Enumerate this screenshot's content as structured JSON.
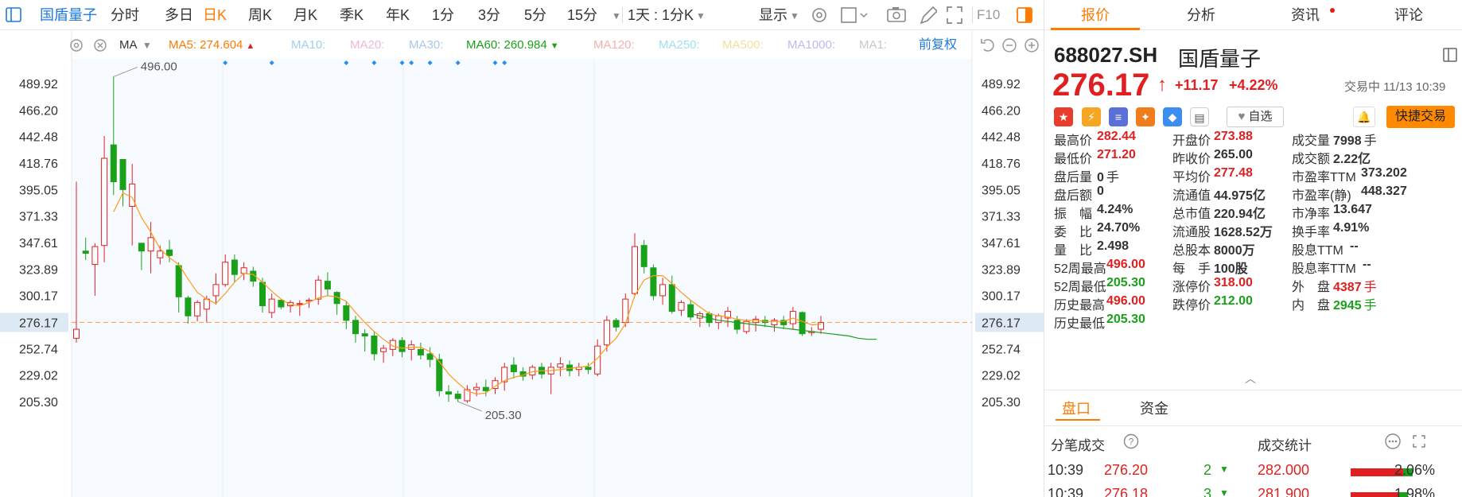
{
  "toolbar": {
    "stock_name": "国盾量子",
    "periods": [
      "分时",
      "多日",
      "日K",
      "周K",
      "月K",
      "季K",
      "年K",
      "1分",
      "3分",
      "5分",
      "15分"
    ],
    "active_period": "日K",
    "multi_period": "1天 : 1分K",
    "display_label": "显示",
    "f10_label": "F10"
  },
  "ma_bar": {
    "indicator": "MA",
    "items": [
      {
        "label": "MA5: 274.604",
        "color": "#ff7a00",
        "arrow": "▲"
      },
      {
        "label": "MA10:",
        "color": "#9fd0f0"
      },
      {
        "label": "MA20:",
        "color": "#f0b8d8"
      },
      {
        "label": "MA30:",
        "color": "#a8c8e8"
      },
      {
        "label": "MA60: 260.984",
        "color": "#1aa11a",
        "arrow": "▼"
      },
      {
        "label": "MA120:",
        "color": "#f4b0b0"
      },
      {
        "label": "MA250:",
        "color": "#9fe0f0"
      },
      {
        "label": "MA500:",
        "color": "#f0e0a0"
      },
      {
        "label": "MA1000:",
        "color": "#c0b8f0"
      },
      {
        "label": "MA1:",
        "color": "#c8c8c8"
      }
    ],
    "adjust_label": "前复权"
  },
  "colors": {
    "up": "#e02020",
    "down": "#1aa11a",
    "accent": "#ff7a00",
    "blue": "#1e7be0"
  },
  "chart_data": {
    "type": "candlestick",
    "y_ticks": [
      489.92,
      466.2,
      442.48,
      418.76,
      395.05,
      371.33,
      347.61,
      323.89,
      300.17,
      276.17,
      252.74,
      229.02,
      205.3
    ],
    "ylim": [
      198,
      500
    ],
    "current_price_label": "276.17",
    "high_annotation": "496.00",
    "low_annotation": "205.30",
    "candles": [
      [
        262,
        402,
        258,
        270
      ],
      [
        340,
        352,
        332,
        338
      ],
      [
        328,
        347,
        300,
        344
      ],
      [
        345,
        443,
        330,
        423
      ],
      [
        435,
        496,
        390,
        402
      ],
      [
        422,
        420,
        380,
        395
      ],
      [
        380,
        418,
        345,
        400
      ],
      [
        347,
        345,
        323,
        340
      ],
      [
        340,
        366,
        320,
        352
      ],
      [
        334,
        345,
        328,
        340
      ],
      [
        341,
        350,
        330,
        336
      ],
      [
        327,
        330,
        285,
        299
      ],
      [
        298,
        300,
        275,
        282
      ],
      [
        282,
        296,
        277,
        294
      ],
      [
        288,
        300,
        276,
        297
      ],
      [
        300,
        320,
        292,
        310
      ],
      [
        310,
        337,
        308,
        330
      ],
      [
        332,
        337,
        312,
        319
      ],
      [
        320,
        330,
        314,
        325
      ],
      [
        322,
        326,
        308,
        313
      ],
      [
        312,
        316,
        285,
        291
      ],
      [
        285,
        302,
        280,
        297
      ],
      [
        296,
        297,
        288,
        290
      ],
      [
        291,
        296,
        285,
        294
      ],
      [
        293,
        296,
        282,
        293
      ],
      [
        295,
        298,
        289,
        296
      ],
      [
        297,
        318,
        292,
        314
      ],
      [
        313,
        321,
        300,
        306
      ],
      [
        303,
        304,
        283,
        293
      ],
      [
        291,
        295,
        270,
        278
      ],
      [
        278,
        282,
        258,
        266
      ],
      [
        266,
        270,
        250,
        264
      ],
      [
        264,
        268,
        242,
        248
      ],
      [
        250,
        256,
        240,
        253
      ],
      [
        252,
        262,
        246,
        260
      ],
      [
        260,
        263,
        245,
        250
      ],
      [
        252,
        260,
        242,
        256
      ],
      [
        252,
        258,
        243,
        247
      ],
      [
        248,
        254,
        236,
        243
      ],
      [
        243,
        248,
        210,
        215
      ],
      [
        214,
        220,
        205,
        212
      ],
      [
        212,
        215,
        205,
        208
      ],
      [
        206,
        220,
        204,
        216
      ],
      [
        216,
        222,
        210,
        218
      ],
      [
        218,
        225,
        210,
        215
      ],
      [
        217,
        227,
        212,
        224
      ],
      [
        223,
        240,
        215,
        236
      ],
      [
        238,
        245,
        226,
        232
      ],
      [
        232,
        236,
        224,
        228
      ],
      [
        229,
        238,
        225,
        236
      ],
      [
        236,
        240,
        226,
        230
      ],
      [
        230,
        240,
        212,
        236
      ],
      [
        236,
        245,
        228,
        239
      ],
      [
        238,
        242,
        228,
        233
      ],
      [
        234,
        240,
        228,
        236
      ],
      [
        236,
        240,
        230,
        234
      ],
      [
        230,
        261,
        228,
        255
      ],
      [
        256,
        282,
        250,
        278
      ],
      [
        278,
        280,
        268,
        272
      ],
      [
        276,
        302,
        272,
        297
      ],
      [
        302,
        356,
        300,
        344
      ],
      [
        345,
        350,
        320,
        326
      ],
      [
        325,
        328,
        296,
        300
      ],
      [
        300,
        316,
        292,
        310
      ],
      [
        310,
        318,
        284,
        286
      ],
      [
        287,
        296,
        282,
        294
      ],
      [
        292,
        296,
        278,
        281
      ],
      [
        280,
        286,
        272,
        284
      ],
      [
        284,
        286,
        272,
        276
      ],
      [
        276,
        284,
        270,
        282
      ],
      [
        280,
        290,
        272,
        286
      ],
      [
        278,
        282,
        266,
        270
      ],
      [
        268,
        279,
        266,
        277
      ],
      [
        276,
        282,
        268,
        279
      ],
      [
        278,
        282,
        272,
        276
      ],
      [
        274,
        280,
        268,
        278
      ],
      [
        278,
        282,
        270,
        274
      ],
      [
        275,
        290,
        270,
        286
      ],
      [
        285,
        286,
        264,
        266
      ],
      [
        267,
        272,
        264,
        268
      ],
      [
        270,
        282,
        266,
        276
      ]
    ],
    "ma5": [
      null,
      null,
      null,
      null,
      375,
      392,
      388,
      370,
      357,
      342,
      334,
      328,
      315,
      303,
      297,
      293,
      302,
      312,
      320,
      319,
      312,
      304,
      297,
      292,
      291,
      294,
      298,
      300,
      299,
      295,
      285,
      276,
      268,
      261,
      255,
      253,
      254,
      254,
      250,
      241,
      230,
      222,
      215,
      212,
      213,
      219,
      224,
      227,
      229,
      232,
      233,
      233,
      234,
      235,
      236,
      237,
      244,
      254,
      262,
      275,
      300,
      314,
      318,
      318,
      311,
      303,
      296,
      290,
      284,
      282,
      281,
      279,
      278,
      278,
      277,
      277,
      277,
      280,
      277,
      274,
      274.6
    ],
    "ma60_start": 66,
    "ma60": [
      284,
      282,
      280,
      278,
      277,
      276,
      275,
      274,
      273,
      272,
      271,
      270,
      269,
      268,
      267,
      266,
      265,
      264,
      262,
      261,
      261
    ],
    "markers": [
      16,
      21,
      29,
      32,
      35,
      36,
      38,
      41,
      45,
      46
    ]
  },
  "panel": {
    "tabs": [
      "报价",
      "分析",
      "资讯",
      "评论"
    ],
    "active_tab": "报价",
    "code": "688027.SH",
    "name": "国盾量子",
    "price": "276.17",
    "arrow": "↑",
    "change": "+11.17",
    "change_pct": "+4.22%",
    "status": "交易中 11/13 10:39",
    "fav_label": "自选",
    "trade_label": "快捷交易",
    "quotes": [
      [
        {
          "label": "最高价",
          "value": "282.44",
          "tone": "up"
        },
        {
          "label": "开盘价",
          "value": "273.88",
          "tone": "up"
        },
        {
          "label": "成交量",
          "value": "7998",
          "unit": "手",
          "tone": "neu"
        }
      ],
      [
        {
          "label": "最低价",
          "value": "271.20",
          "tone": "up"
        },
        {
          "label": "昨收价",
          "value": "265.00",
          "tone": "neu"
        },
        {
          "label": "成交额",
          "value": "2.22亿",
          "tone": "neu"
        }
      ],
      [
        {
          "label": "盘后量",
          "value": "0",
          "unit": "手",
          "tone": "neu"
        },
        {
          "label": "平均价",
          "value": "277.48",
          "tone": "up"
        },
        {
          "label": "市盈率TTM",
          "value": "373.202",
          "tone": "neu"
        }
      ],
      [
        {
          "label": "盘后额",
          "value": "0",
          "tone": "neu"
        },
        {
          "label": "流通值",
          "value": "44.975亿",
          "tone": "neu"
        },
        {
          "label": "市盈率(静)",
          "value": "448.327",
          "tone": "neu"
        }
      ],
      [
        {
          "label": "振　幅",
          "value": "4.24%",
          "tone": "neu"
        },
        {
          "label": "总市值",
          "value": "220.94亿",
          "tone": "neu"
        },
        {
          "label": "市净率",
          "value": "13.647",
          "tone": "neu"
        }
      ],
      [
        {
          "label": "委　比",
          "value": "24.70%",
          "tone": "neu"
        },
        {
          "label": "流通股",
          "value": "1628.52万",
          "tone": "neu"
        },
        {
          "label": "换手率",
          "value": "4.91%",
          "tone": "neu"
        }
      ],
      [
        {
          "label": "量　比",
          "value": "2.498",
          "tone": "neu"
        },
        {
          "label": "总股本",
          "value": "8000万",
          "tone": "neu"
        },
        {
          "label": "股息TTM",
          "value": "--",
          "tone": "neu"
        }
      ],
      [
        {
          "label": "52周最高",
          "value": "496.00",
          "tone": "up"
        },
        {
          "label": "每　手",
          "value": "100股",
          "tone": "neu"
        },
        {
          "label": "股息率TTM",
          "value": "--",
          "tone": "neu"
        }
      ],
      [
        {
          "label": "52周最低",
          "value": "205.30",
          "tone": "down"
        },
        {
          "label": "涨停价",
          "value": "318.00",
          "tone": "up"
        },
        {
          "label": "外　盘",
          "value": "4387",
          "unit": "手",
          "tone": "up"
        }
      ],
      [
        {
          "label": "历史最高",
          "value": "496.00",
          "tone": "up"
        },
        {
          "label": "跌停价",
          "value": "212.00",
          "tone": "down"
        },
        {
          "label": "内　盘",
          "value": "2945",
          "unit": "手",
          "tone": "down"
        }
      ],
      [
        {
          "label": "历史最低",
          "value": "205.30",
          "tone": "down"
        }
      ]
    ],
    "sub_tabs": [
      "盘口",
      "资金"
    ],
    "trades_title": "分笔成交",
    "stats_title": "成交统计",
    "trades": [
      {
        "time": "10:39",
        "price": "276.20",
        "vol": "2",
        "stat_price": "282.000",
        "stat_pct": "2.06%",
        "bar": 0.55
      },
      {
        "time": "10:39",
        "price": "276.18",
        "vol": "3",
        "stat_price": "281.900",
        "stat_pct": "1.98%",
        "bar": 0.5
      }
    ]
  }
}
